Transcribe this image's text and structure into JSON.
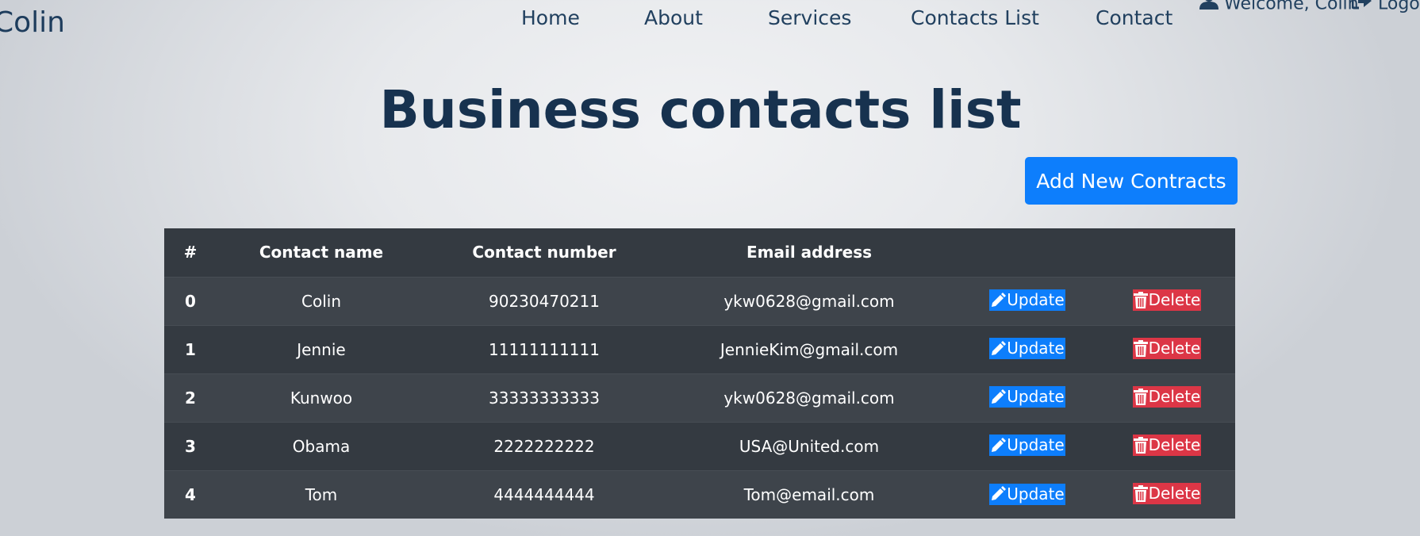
{
  "brand": "Colin",
  "nav": {
    "items": [
      "Home",
      "About",
      "Services",
      "Contacts List",
      "Contact"
    ],
    "welcome": "Welcome, Colin",
    "logout": "Logout"
  },
  "page": {
    "title": "Business contacts list",
    "add_button": "Add New Contracts"
  },
  "table": {
    "headers": [
      "#",
      "Contact name",
      "Contact number",
      "Email address",
      "",
      ""
    ],
    "update_label": "Update",
    "delete_label": "Delete",
    "rows": [
      {
        "index": "0",
        "name": "Colin",
        "number": "90230470211",
        "email": "ykw0628@gmail.com"
      },
      {
        "index": "1",
        "name": "Jennie",
        "number": "11111111111",
        "email": "JennieKim@gmail.com"
      },
      {
        "index": "2",
        "name": "Kunwoo",
        "number": "33333333333",
        "email": "ykw0628@gmail.com"
      },
      {
        "index": "3",
        "name": "Obama",
        "number": "2222222222",
        "email": "USA@United.com"
      },
      {
        "index": "4",
        "name": "Tom",
        "number": "4444444444",
        "email": "Tom@email.com"
      }
    ]
  },
  "colors": {
    "primary": "#0d7efc",
    "danger": "#dc3646",
    "table_dark": "#343a41",
    "heading": "#17324f"
  },
  "icons": {
    "user": "user-icon",
    "logout": "sign-out-icon",
    "update": "pencil-icon",
    "delete": "trash-icon"
  }
}
